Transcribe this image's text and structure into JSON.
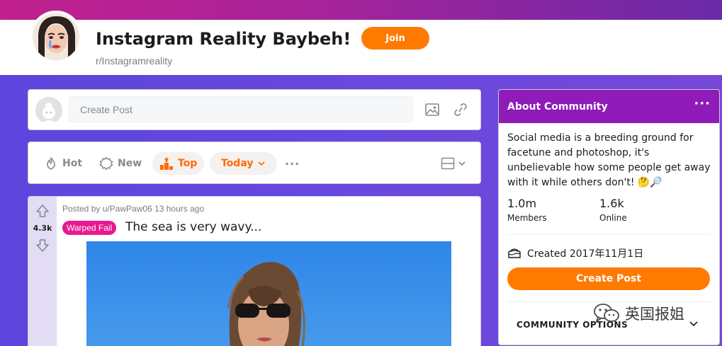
{
  "header": {
    "title": "Instagram Reality Baybeh!",
    "subreddit": "r/Instagramreality",
    "join_label": "Join"
  },
  "create_post": {
    "placeholder": "Create Post",
    "image_icon": "image-icon",
    "link_icon": "link-icon"
  },
  "sort_bar": {
    "hot_label": "Hot",
    "new_label": "New",
    "top_label": "Top",
    "time_label": "Today",
    "more_label": "···"
  },
  "post": {
    "votes": "4.3k",
    "posted_by": "Posted by u/PawPaw06 13 hours ago",
    "flair": "Warped Fail",
    "title": "The sea is very wavy..."
  },
  "about": {
    "title": "About Community",
    "more_label": "···",
    "description": "Social media is a breeding ground for facetune and photoshop, it's unbelievable how some people get away with it while others don't! 🤔🔎",
    "members_value": "1.0m",
    "members_label": "Members",
    "online_value": "1.6k",
    "online_label": "Online",
    "created": "Created 2017年11月1日",
    "create_post_label": "Create Post",
    "community_options": "COMMUNITY OPTIONS"
  },
  "watermark": "英国报姐",
  "colors": {
    "accent_orange": "#ff7a00",
    "about_header": "#8f1bb8",
    "flair": "#e8188f",
    "page_background": "#6a3fd9"
  }
}
